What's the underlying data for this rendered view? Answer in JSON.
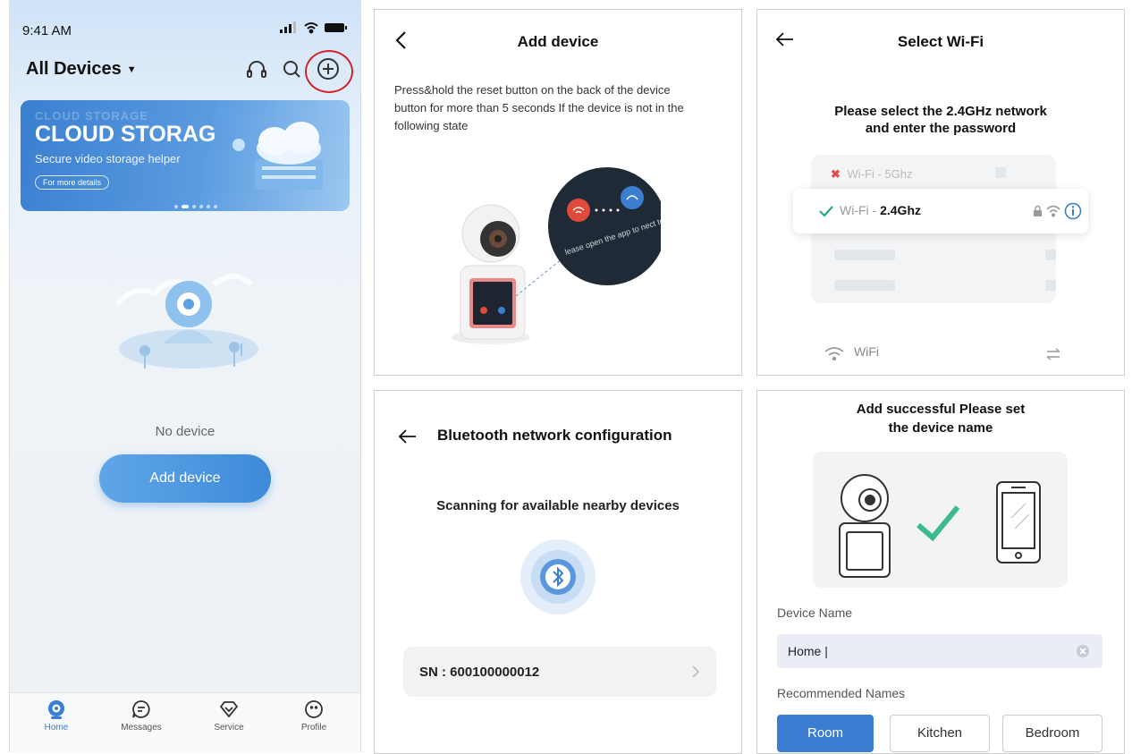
{
  "home": {
    "time": "9:41 AM",
    "title": "All Devices",
    "banner": {
      "ghost": "CLOUD STORAGE",
      "title": "CLOUD STORAG",
      "subtitle": "Secure video storage helper",
      "link": "For more details"
    },
    "empty_text": "No device",
    "add_button": "Add device",
    "tabs": [
      {
        "label": "Home"
      },
      {
        "label": "Messages"
      },
      {
        "label": "Service"
      },
      {
        "label": "Profile"
      }
    ],
    "accent": "#3b7fd4",
    "highlight_ring_color": "#d2232a"
  },
  "add_device": {
    "title": "Add device",
    "instructions": "Press&hold the reset button on the back of the device button for more than 5 seconds If the device is not in the following state",
    "bubble_text": "lease open the app to nect to the network"
  },
  "select_wifi": {
    "title": "Select Wi-Fi",
    "prompt_line1": "Please select the 2.4GHz network",
    "prompt_line2": "and enter the password",
    "networks": [
      {
        "prefix": "Wi-Fi - ",
        "band": "5Ghz",
        "supported": false
      },
      {
        "prefix": "Wi-Fi - ",
        "band": "2.4Ghz",
        "supported": true
      }
    ],
    "footer_label": "WiFi"
  },
  "bluetooth": {
    "title": "Bluetooth network configuration",
    "scanning": "Scanning for available nearby devices",
    "device_sn": "SN : 600100000012"
  },
  "success": {
    "line1": "Add successful Please set",
    "line2": "the device name",
    "name_label": "Device Name",
    "name_value": "Home |",
    "recommended_label": "Recommended Names",
    "chips": [
      {
        "label": "Room",
        "selected": true
      },
      {
        "label": "Kitchen",
        "selected": false
      },
      {
        "label": "Bedroom",
        "selected": false
      }
    ]
  }
}
